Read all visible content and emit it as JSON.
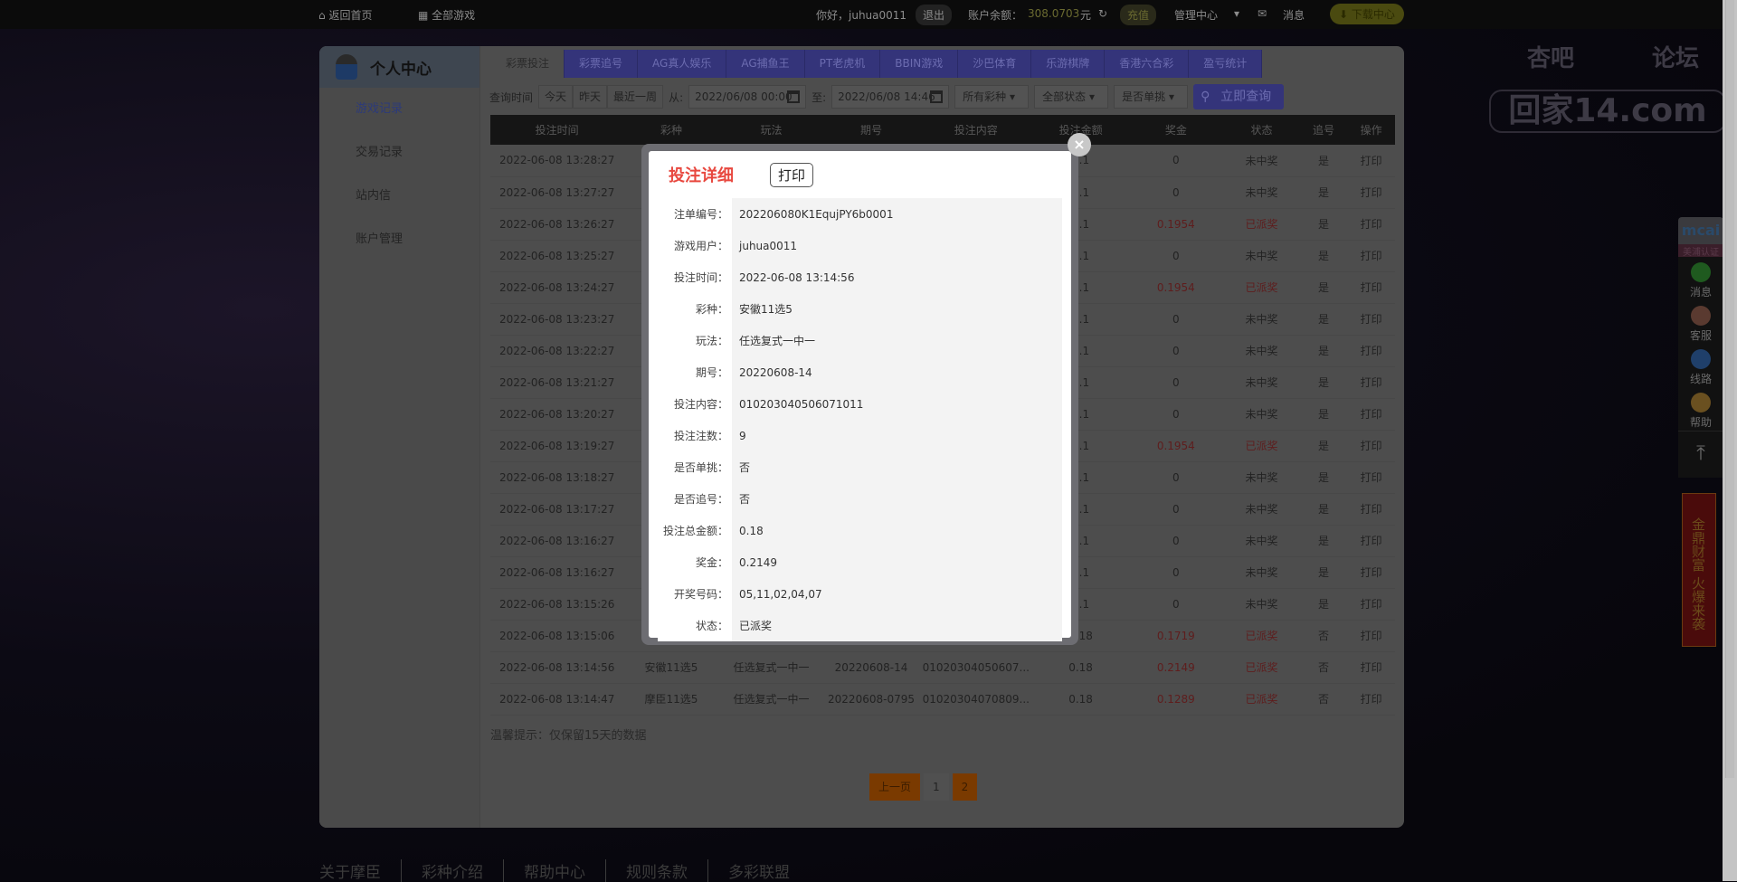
{
  "topbar": {
    "home": "返回首页",
    "all_games": "全部游戏",
    "greeting": "你好，juhua0011",
    "logout": "退出",
    "balance_label": "账户余额：",
    "balance": "308.0703",
    "currency": "元",
    "recharge": "充值",
    "manage": "管理中心",
    "messages": "消息",
    "download": "下载中心"
  },
  "logo": {
    "line1": "杏吧",
    "line2": "论坛",
    "line3": "回家14.com"
  },
  "sidebar": {
    "title": "个人中心",
    "items": [
      {
        "label": "游戏记录"
      },
      {
        "label": "交易记录"
      },
      {
        "label": "站内信"
      },
      {
        "label": "账户管理"
      }
    ]
  },
  "tabs": [
    {
      "label": "彩票投注"
    },
    {
      "label": "彩票追号"
    },
    {
      "label": "AG真人娱乐"
    },
    {
      "label": "AG捕鱼王"
    },
    {
      "label": "PT老虎机"
    },
    {
      "label": "BBIN游戏"
    },
    {
      "label": "沙巴体育"
    },
    {
      "label": "乐游棋牌"
    },
    {
      "label": "香港六合彩"
    },
    {
      "label": "盈亏统计"
    }
  ],
  "filters": {
    "label": "查询时间",
    "today": "今天",
    "yesterday": "昨天",
    "week": "最近一周",
    "from": "从:",
    "from_value": "2022/06/08 00:00",
    "to": "至:",
    "to_value": "2022/06/08 14:46",
    "lottery": "所有彩种",
    "status": "全部状态",
    "single": "是否单挑",
    "query": "立即查询"
  },
  "table": {
    "headers": [
      "投注时间",
      "彩种",
      "玩法",
      "期号",
      "投注内容",
      "投注金额",
      "奖金",
      "状态",
      "追号",
      "操作"
    ],
    "rows": [
      [
        "2022-06-08 13:28:27",
        "",
        "",
        "",
        "",
        "0.1",
        "0",
        "未中奖",
        "是",
        "打印"
      ],
      [
        "2022-06-08 13:27:27",
        "",
        "",
        "",
        "",
        "0.1",
        "0",
        "未中奖",
        "是",
        "打印"
      ],
      [
        "2022-06-08 13:26:27",
        "",
        "",
        "",
        "",
        "0.1",
        "0.1954",
        "已派奖",
        "是",
        "打印"
      ],
      [
        "2022-06-08 13:25:27",
        "",
        "",
        "",
        "",
        "0.1",
        "0",
        "未中奖",
        "是",
        "打印"
      ],
      [
        "2022-06-08 13:24:27",
        "",
        "",
        "",
        "",
        "0.1",
        "0.1954",
        "已派奖",
        "是",
        "打印"
      ],
      [
        "2022-06-08 13:23:27",
        "",
        "",
        "",
        "",
        "0.1",
        "0",
        "未中奖",
        "是",
        "打印"
      ],
      [
        "2022-06-08 13:22:27",
        "",
        "",
        "",
        "",
        "0.1",
        "0",
        "未中奖",
        "是",
        "打印"
      ],
      [
        "2022-06-08 13:21:27",
        "",
        "",
        "",
        "",
        "0.1",
        "0",
        "未中奖",
        "是",
        "打印"
      ],
      [
        "2022-06-08 13:20:27",
        "",
        "",
        "",
        "",
        "0.1",
        "0",
        "未中奖",
        "是",
        "打印"
      ],
      [
        "2022-06-08 13:19:27",
        "",
        "",
        "",
        "",
        "0.1",
        "0.1954",
        "已派奖",
        "是",
        "打印"
      ],
      [
        "2022-06-08 13:18:27",
        "",
        "",
        "",
        "",
        "0.1",
        "0",
        "未中奖",
        "是",
        "打印"
      ],
      [
        "2022-06-08 13:17:27",
        "",
        "",
        "",
        "",
        "0.1",
        "0",
        "未中奖",
        "是",
        "打印"
      ],
      [
        "2022-06-08 13:16:27",
        "",
        "",
        "",
        "",
        "0.1",
        "0",
        "未中奖",
        "是",
        "打印"
      ],
      [
        "2022-06-08 13:16:27",
        "",
        "",
        "",
        "",
        "0.1",
        "0",
        "未中奖",
        "是",
        "打印"
      ],
      [
        "2022-06-08 13:15:26",
        "",
        "",
        "",
        "",
        "0.1",
        "0",
        "未中奖",
        "是",
        "打印"
      ],
      [
        "2022-06-08 13:15:06",
        "",
        "",
        "",
        "",
        "0.18",
        "0.1719",
        "已派奖",
        "否",
        "打印"
      ],
      [
        "2022-06-08 13:14:56",
        "安徽11选5",
        "任选复式一中一",
        "20220608-14",
        "01020304050607...",
        "0.18",
        "0.2149",
        "已派奖",
        "否",
        "打印"
      ],
      [
        "2022-06-08 13:14:47",
        "摩臣11选5",
        "任选复式一中一",
        "20220608-0795",
        "01020304070809...",
        "0.18",
        "0.1289",
        "已派奖",
        "否",
        "打印"
      ]
    ]
  },
  "hint": "温馨提示：仅保留15天的数据",
  "pager": {
    "prev": "上一页",
    "pages": [
      "1",
      "2"
    ],
    "current": "2"
  },
  "footer": [
    "关于摩臣",
    "彩种介绍",
    "帮助中心",
    "规则条款",
    "多彩联盟"
  ],
  "rail": {
    "badge": "mcai",
    "badge_sub": "美浦认证",
    "items": [
      "消息",
      "客服",
      "线路",
      "帮助"
    ],
    "banner": "金鼎财富 火爆来袭"
  },
  "modal": {
    "title": "投注详细",
    "print": "打印",
    "rows": [
      {
        "label": "注单编号：",
        "value": "202206080K1EqujPY6b0001"
      },
      {
        "label": "游戏用户：",
        "value": "juhua0011"
      },
      {
        "label": "投注时间：",
        "value": "2022-06-08 13:14:56"
      },
      {
        "label": "彩种：",
        "value": "安徽11选5"
      },
      {
        "label": "玩法：",
        "value": "任选复式一中一"
      },
      {
        "label": "期号：",
        "value": "20220608-14"
      },
      {
        "label": "投注内容：",
        "value": "010203040506071011"
      },
      {
        "label": "投注注数：",
        "value": "9"
      },
      {
        "label": "是否单挑：",
        "value": "否"
      },
      {
        "label": "是否追号：",
        "value": "否"
      },
      {
        "label": "投注总金额：",
        "value": "0.18"
      },
      {
        "label": "奖金：",
        "value": "0.2149"
      },
      {
        "label": "开奖号码：",
        "value": "05,11,02,04,07"
      },
      {
        "label": "状态：",
        "value": "已派奖"
      }
    ]
  },
  "colors": {
    "accent_red": "#e8483f",
    "tab_blue": "#5b5bd6",
    "pager_orange": "#e06a00"
  }
}
